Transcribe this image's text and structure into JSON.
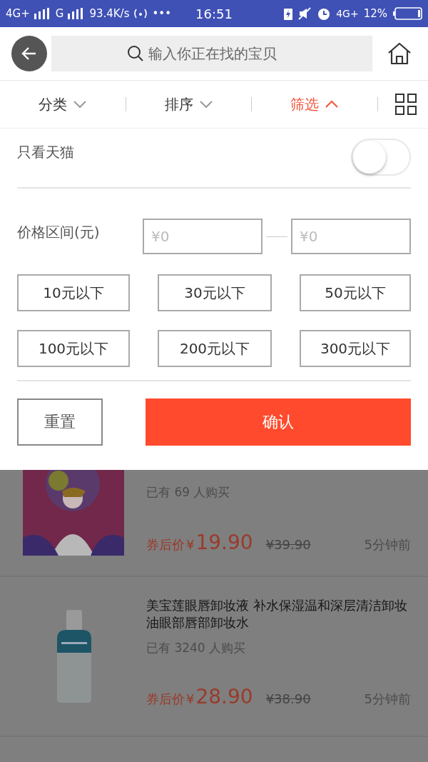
{
  "status_bar": {
    "left": [
      "4G+",
      "G"
    ],
    "speed": "93.4K/s",
    "more": "•••",
    "time": "16:51",
    "network": "4G+",
    "battery": "12%"
  },
  "search": {
    "placeholder": "输入你正在找的宝贝"
  },
  "tabs": [
    {
      "label": "分类",
      "selected": false
    },
    {
      "label": "排序",
      "selected": false
    },
    {
      "label": "筛选",
      "selected": true
    }
  ],
  "filter": {
    "tmall_label": "只看天猫",
    "tmall_on": false,
    "price_label": "价格区间(元)",
    "min_placeholder": "¥0",
    "max_placeholder": "¥0",
    "presets": [
      "10元以下",
      "30元以下",
      "50元以下",
      "100元以下",
      "200元以下",
      "300元以下"
    ],
    "reset": "重置",
    "confirm": "确认"
  },
  "products": [
    {
      "sold": "已有 69 人购买",
      "price_label": "券后价",
      "currency": "¥",
      "price": "19.90",
      "old_price": "¥39.90",
      "time": "5分钟前",
      "kind": "picture"
    },
    {
      "title": "美宝莲眼唇卸妆液 补水保湿温和深层清洁卸妆油眼部唇部卸妆水",
      "sold": "已有 3240 人购买",
      "price_label": "券后价",
      "currency": "¥",
      "price": "28.90",
      "old_price": "¥38.90",
      "time": "5分钟前",
      "kind": "picture"
    }
  ]
}
